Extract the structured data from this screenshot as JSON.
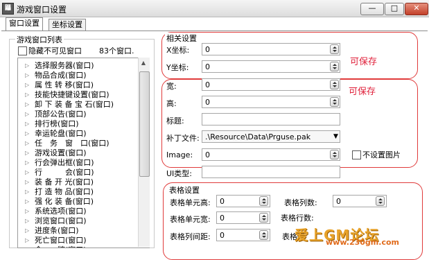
{
  "window": {
    "icon_glyph": "鼺",
    "title": "游戏窗口设置",
    "min_glyph": "—",
    "max_glyph": "□",
    "close_glyph": "✕"
  },
  "tabs": [
    {
      "label": "窗口设置"
    },
    {
      "label": "坐标设置"
    }
  ],
  "list_group": {
    "title": "游戏窗口列表",
    "hide_invisible_label": "隐藏不可见窗口",
    "count_label": "83个窗口."
  },
  "tree_items": [
    "选择服务器(窗口)",
    "物品合成(窗口)",
    "属 性 转 移(窗口)",
    "技能快捷键设置(窗口)",
    "卸 下 装 备 宝 石(窗口)",
    "顶部公告(窗口)",
    "排行榜(窗口)",
    "幸运轮盘(窗口)",
    "任　务　窗　口(窗口)",
    "游戏设置(窗口)",
    "行会弹出框(窗口)",
    "行　　　会(窗口)",
    "装 备 开 光(窗口)",
    "打 造 物 品(窗口)",
    "强 化 装 备(窗口)",
    "系统选项(窗口)",
    "浏览窗口(窗口)",
    "进度条(窗口)",
    "死亡窗口(窗口)",
    "令　　牌(窗口)"
  ],
  "position_group": {
    "title": "相关设置",
    "x_label": "X坐标:",
    "x_value": "0",
    "y_label": "Y坐标:",
    "y_value": "0",
    "savable_note": "可保存"
  },
  "size_group": {
    "width_label": "宽:",
    "width_value": "0",
    "height_label": "高:",
    "height_value": "0",
    "caption_label": "标题:",
    "caption_value": "",
    "patch_label": "补丁文件:",
    "patch_value": ".\\Resource\\Data\\Prguse.pak",
    "image_label": "Image:",
    "image_value": "0",
    "no_image_label": "不设置图片",
    "savable_note": "可保存"
  },
  "ui_type": {
    "label": "UI类型:",
    "value": ""
  },
  "table_group": {
    "title": "表格设置",
    "cell_height_label": "表格单元高:",
    "cell_height_value": "0",
    "cols_label": "表格列数:",
    "cols_value": "0",
    "cell_width_label": "表格单元宽:",
    "cell_width_value": "0",
    "rows_label": "表格行数:",
    "col_gap_label": "表格列间距:",
    "col_gap_value": "0",
    "row_gap_label": "表格行"
  },
  "watermark": {
    "text": "爱上GM论坛",
    "url": "www.230gm.com"
  },
  "colors": {
    "annotation_red": "#e03a3a",
    "watermark_orange": "#e8a32a"
  }
}
